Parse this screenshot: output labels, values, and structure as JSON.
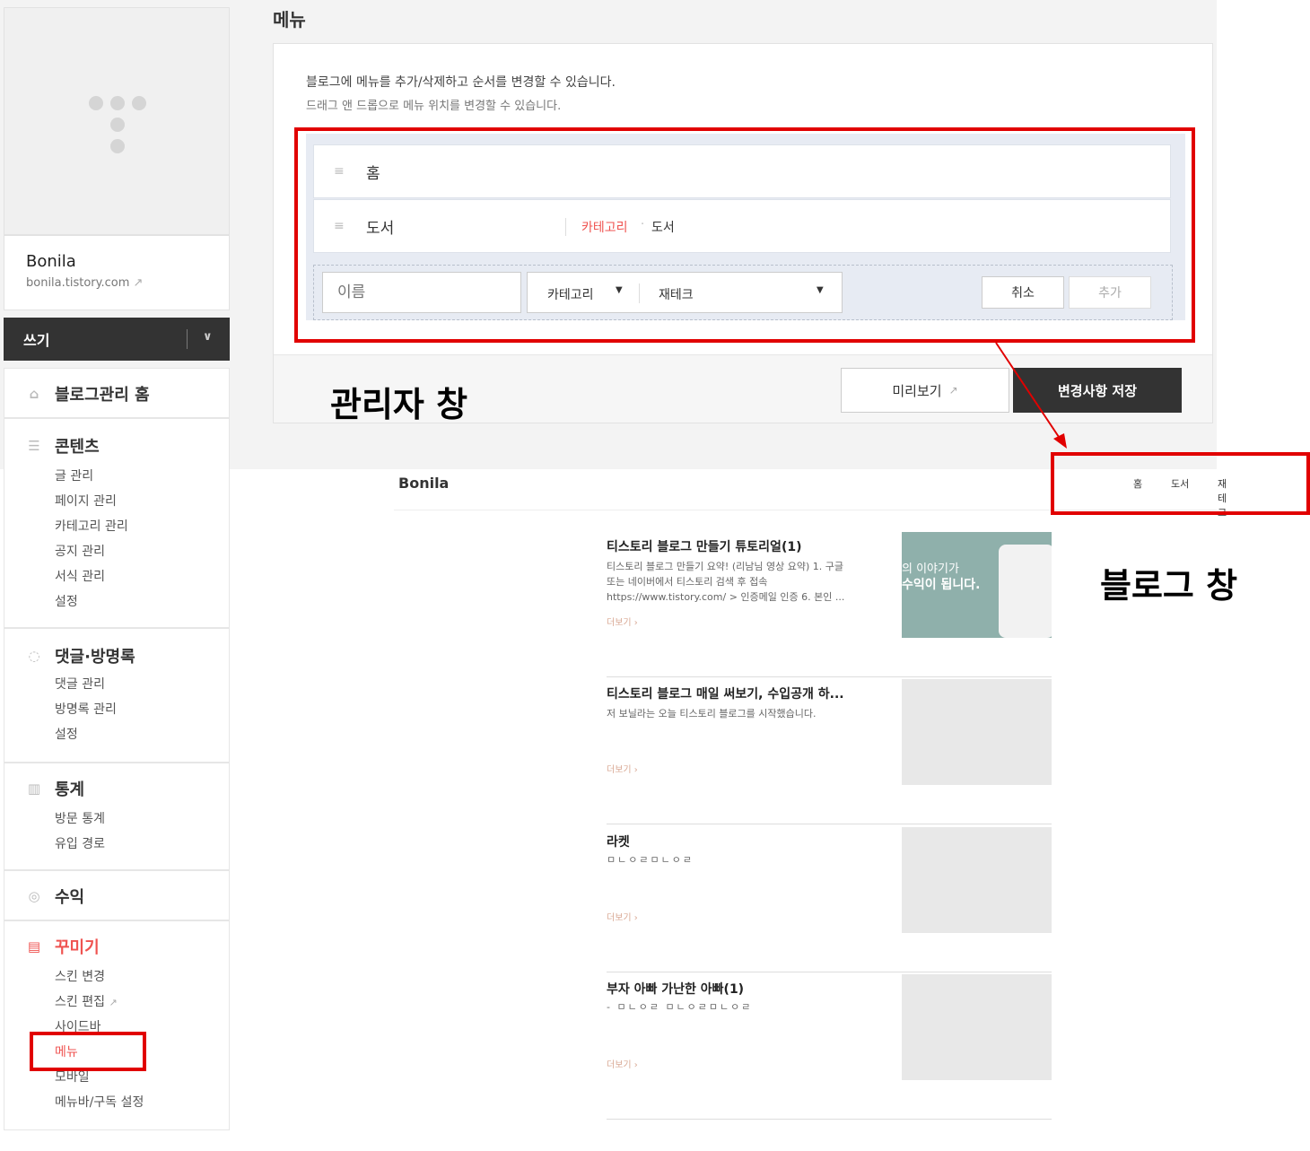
{
  "sidebar": {
    "blog_name": "Bonila",
    "blog_url": "bonila.tistory.com",
    "write_label": "쓰기",
    "home_label": "블로그관리 홈",
    "sections": [
      {
        "title": "콘텐츠",
        "items": [
          "글 관리",
          "페이지 관리",
          "카테고리 관리",
          "공지 관리",
          "서식 관리",
          "설정"
        ]
      },
      {
        "title": "댓글·방명록",
        "items": [
          "댓글 관리",
          "방명록 관리",
          "설정"
        ]
      },
      {
        "title": "통계",
        "items": [
          "방문 통계",
          "유입 경로"
        ]
      },
      {
        "title": "수익",
        "items": []
      },
      {
        "title": "꾸미기",
        "items": [
          "스킨 변경",
          "스킨 편집",
          "사이드바",
          "메뉴",
          "모바일",
          "메뉴바/구독 설정"
        ]
      }
    ],
    "active_color": "#ef5350"
  },
  "main": {
    "title": "메뉴",
    "desc1": "블로그에 메뉴를 추가/삭제하고 순서를 변경할 수 있습니다.",
    "desc2": "드래그 앤 드롭으로 메뉴 위치를 변경할 수 있습니다.",
    "menu_rows": [
      {
        "label": "홈"
      },
      {
        "label": "도서",
        "type": "카테고리",
        "value": "도서"
      }
    ],
    "add_row": {
      "name_placeholder": "이름",
      "type": "카테고리",
      "value": "재테크",
      "cancel": "취소",
      "add": "추가"
    },
    "preview_label": "미리보기",
    "save_label": "변경사항 저장"
  },
  "annotations": {
    "admin": "관리자 창",
    "blog": "블로그 창",
    "highlight_color": "#e10000"
  },
  "blog": {
    "name": "Bonila",
    "nav": [
      "홈",
      "도서",
      "재테크"
    ],
    "more": "더보기",
    "posts": [
      {
        "title": "티스토리 블로그 만들기 튜토리얼(1)",
        "excerpt": "티스토리 블로그 만들기 요약! (리남님 영상 요약) 1. 구글 또는 네이버에서 티스토리 검색 후 접속 https://www.tistory.com/ > 인증메일 인증 6. 본인 ...",
        "thumb_line1": "의 이야기가",
        "thumb_line2": "수익이 됩니다."
      },
      {
        "title": "티스토리 블로그 매일 써보기, 수입공개 하...",
        "excerpt": "저 보닐라는 오늘 티스토리 블로그를 시작했습니다."
      },
      {
        "title": "라켓",
        "excerpt": "ㅁㄴㅇㄹㅁㄴㅇㄹ"
      },
      {
        "title": "부자 아빠 가난한 아빠(1)",
        "excerpt": "- ㅁㄴㅇㄹ ㅁㄴㅇㄹㅁㄴㅇㄹ"
      }
    ]
  }
}
